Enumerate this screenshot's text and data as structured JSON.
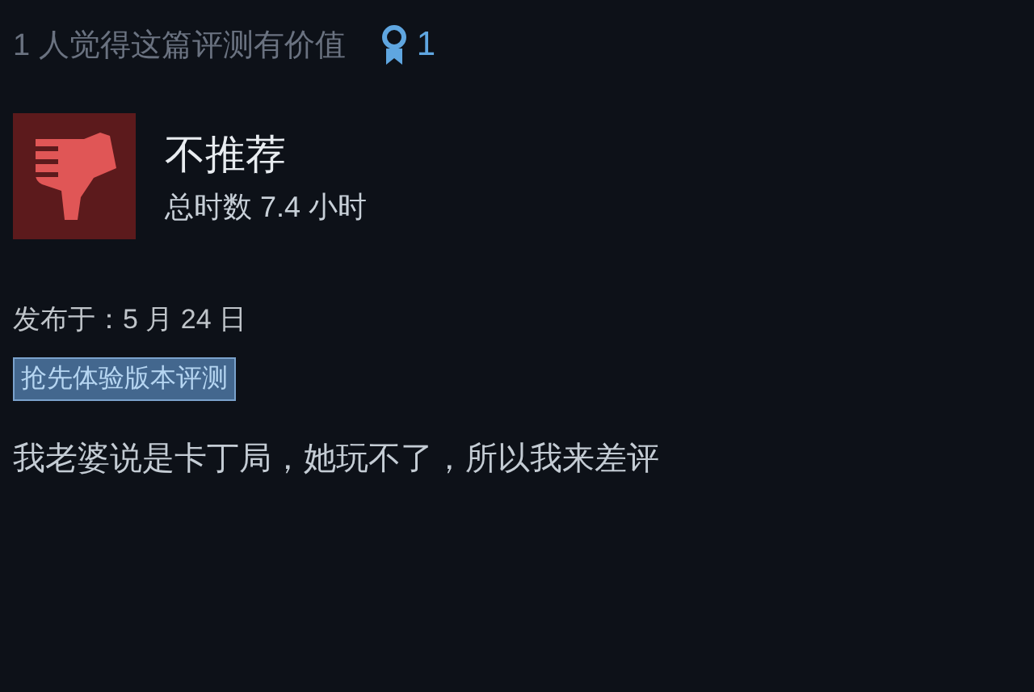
{
  "helpful": {
    "text": "1 人觉得这篇评测有价值",
    "awards": "1"
  },
  "review": {
    "kind": "not_recommended",
    "verdict": "不推荐",
    "hours": "总时数 7.4 小时"
  },
  "posted": "发布于：5 月 24 日",
  "tag": "抢先体验版本评测",
  "body": "我老婆说是卡丁局，她玩不了，所以我来差评"
}
